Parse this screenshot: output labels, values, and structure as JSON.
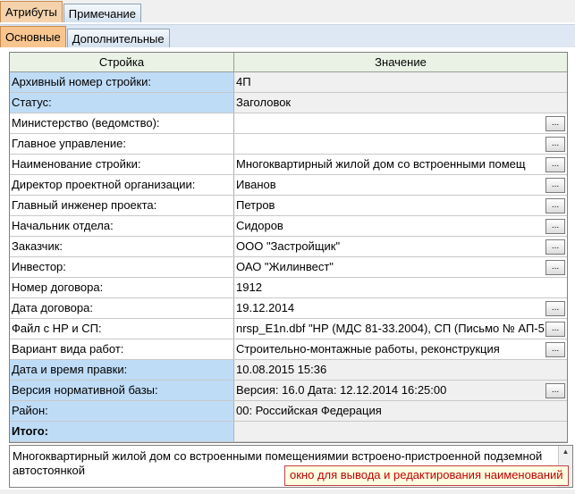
{
  "tabs_top": [
    {
      "label": "Атрибуты",
      "active": true
    },
    {
      "label": "Примечание",
      "active": false
    }
  ],
  "tabs_sub": [
    {
      "label": "Основные",
      "active": true
    },
    {
      "label": "Дополнительные",
      "active": false
    }
  ],
  "grid": {
    "col_header_1": "Стройка",
    "col_header_2": "Значение",
    "button_label": "...",
    "rows": [
      {
        "label": "Архивный номер стройки:",
        "value": "4П",
        "editable": false,
        "button": false
      },
      {
        "label": "Статус:",
        "value": "Заголовок",
        "editable": false,
        "button": false
      },
      {
        "label": "Министерство (ведомство):",
        "value": "",
        "editable": true,
        "button": true
      },
      {
        "label": "Главное управление:",
        "value": "",
        "editable": true,
        "button": true
      },
      {
        "label": "Наименование стройки:",
        "value": "Многоквартирный жилой дом со встроенными помещ",
        "editable": true,
        "button": true
      },
      {
        "label": "Директор проектной организации:",
        "value": "Иванов",
        "editable": true,
        "button": true
      },
      {
        "label": "Главный инженер проекта:",
        "value": "Петров",
        "editable": true,
        "button": true
      },
      {
        "label": "Начальник отдела:",
        "value": "Сидоров",
        "editable": true,
        "button": true
      },
      {
        "label": "Заказчик:",
        "value": "ООО \"Застройщик\"",
        "editable": true,
        "button": true
      },
      {
        "label": "Инвестор:",
        "value": "ОАО \"Жилинвест\"",
        "editable": true,
        "button": true
      },
      {
        "label": "Номер договора:",
        "value": "1912",
        "editable": true,
        "button": false
      },
      {
        "label": "Дата договора:",
        "value": "19.12.2014",
        "editable": true,
        "button": true
      },
      {
        "label": "Файл с НР и СП:",
        "value": "nrsp_E1n.dbf  \"НР (МДС 81-33.2004), СП (Письмо № АП-5",
        "editable": true,
        "button": true
      },
      {
        "label": "Вариант вида работ:",
        "value": "Строительно-монтажные работы, реконструкция",
        "editable": true,
        "button": true
      },
      {
        "label": "Дата и время правки:",
        "value": "10.08.2015  15:36",
        "editable": false,
        "button": false
      },
      {
        "label": "Версия нормативной базы:",
        "value": "Версия: 16.0   Дата: 12.12.2014 16:25:00",
        "editable": false,
        "button": true
      },
      {
        "label": "Район:",
        "value": "00: Российская Федерация",
        "editable": false,
        "button": false
      }
    ],
    "total_label": "Итого:"
  },
  "memo": {
    "text": "Многоквартирный жилой дом со встроенными помещениямии встроено-пристроенной подземной автостоянкой",
    "tooltip": "окно для вывода и редактирования наименований"
  }
}
